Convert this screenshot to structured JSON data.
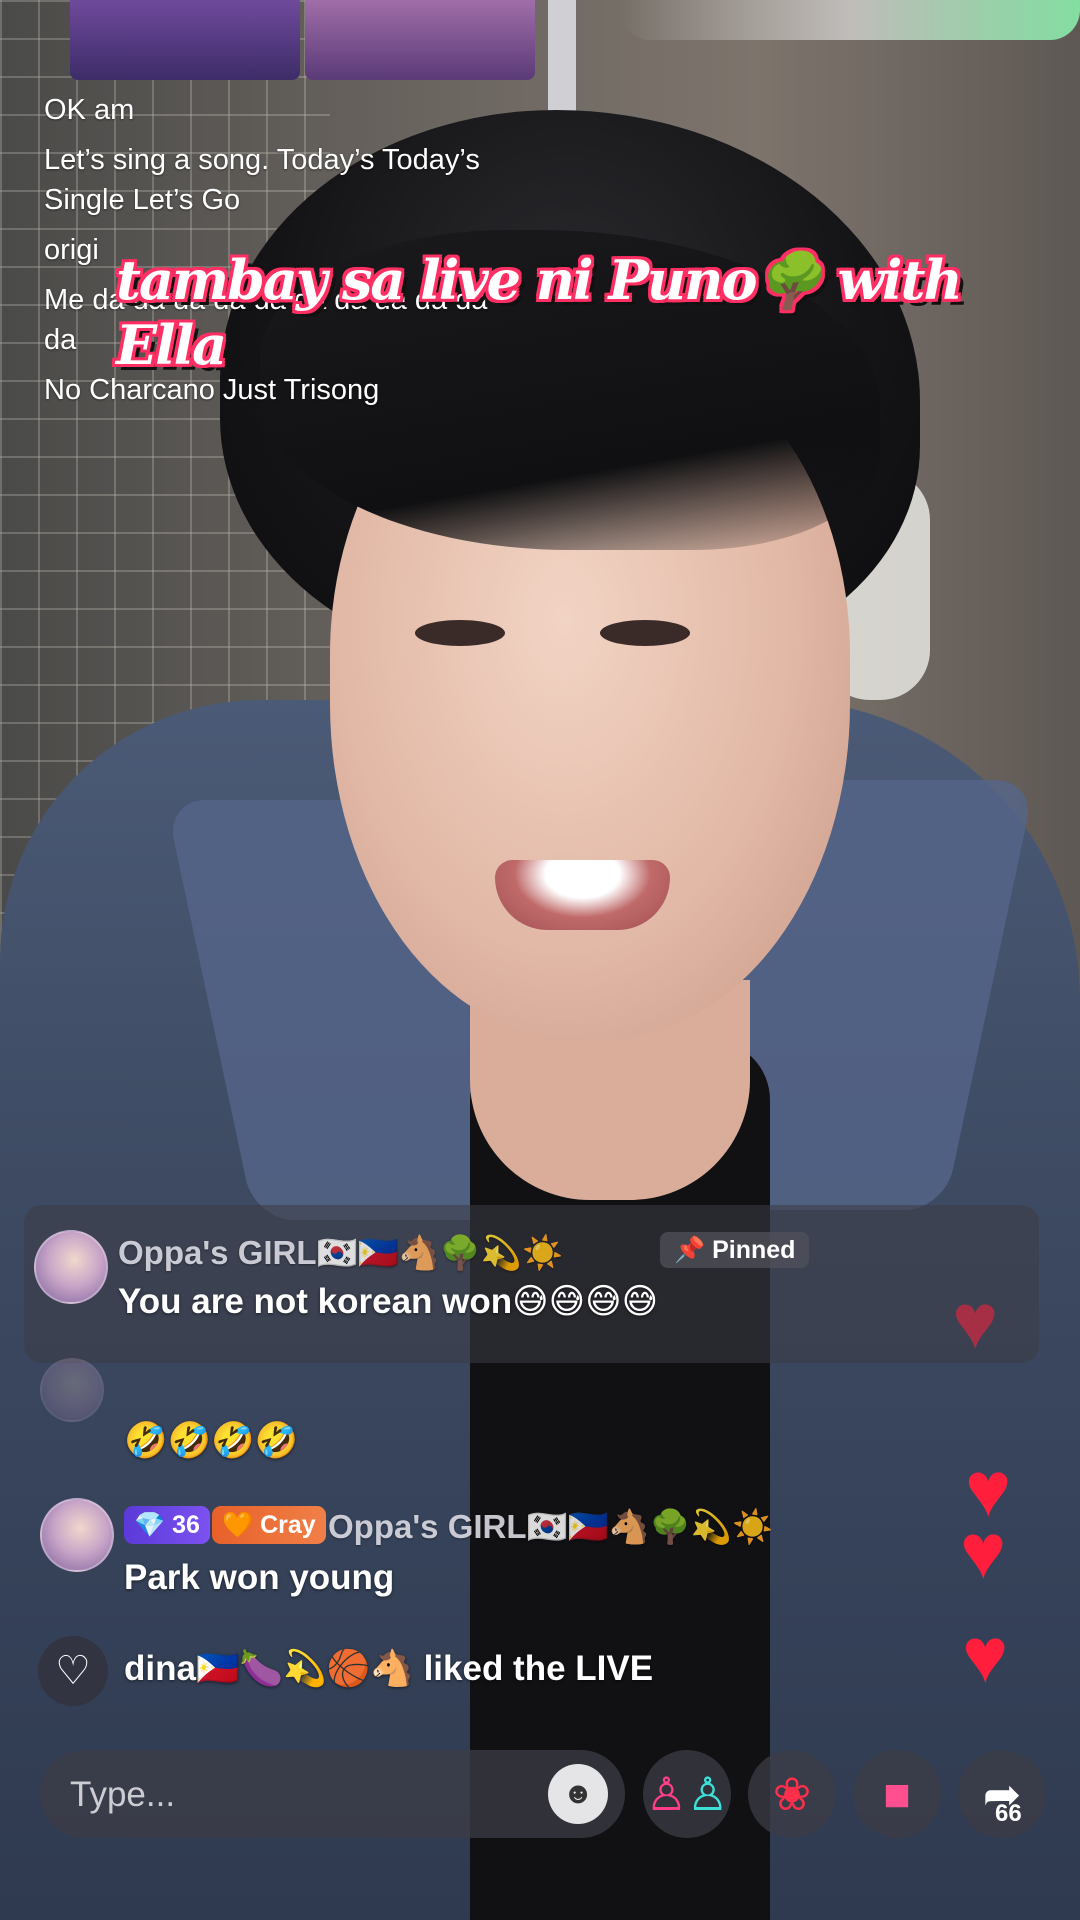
{
  "caption": {
    "lines": [
      "OK am",
      "Let’s sing a song. Today’s Today’s Single Let’s Go",
      "origi",
      "Me da da da da da da da da da da da",
      "No Charcano Just Trisong"
    ]
  },
  "title_banner": "tambay sa live ni Puno🌳 with Ella",
  "pinned": {
    "username": "Oppa's GIRL🇰🇷🇵🇭🐴🌳💫☀️",
    "badge": "📌 Pinned",
    "message": "You are not korean won😅😅😅😅"
  },
  "faded_message": "🤣🤣🤣🤣",
  "comment": {
    "level": "💎 36",
    "fan_badge": "🧡 Cray",
    "username": "Oppa's GIRL🇰🇷🇵🇭🐴🌳💫☀️",
    "message": "Park won young"
  },
  "like_event": {
    "text": "dina🇵🇭🍆💫🏀🐴 liked the LIVE"
  },
  "input": {
    "placeholder": "Type..."
  },
  "share": {
    "count": "66"
  },
  "icons": {
    "emoji": "emoji-face-icon",
    "guests": "multi-guest-icon",
    "rose": "rose-gift-icon",
    "gift": "gift-box-icon",
    "share": "share-arrow-icon",
    "heart": "heart-outline-icon"
  },
  "colors": {
    "title_stroke": "#ff2e63",
    "heart": "#ff1f3d",
    "level_badge": "#6a46e8",
    "fan_badge": "#ec6a36"
  }
}
